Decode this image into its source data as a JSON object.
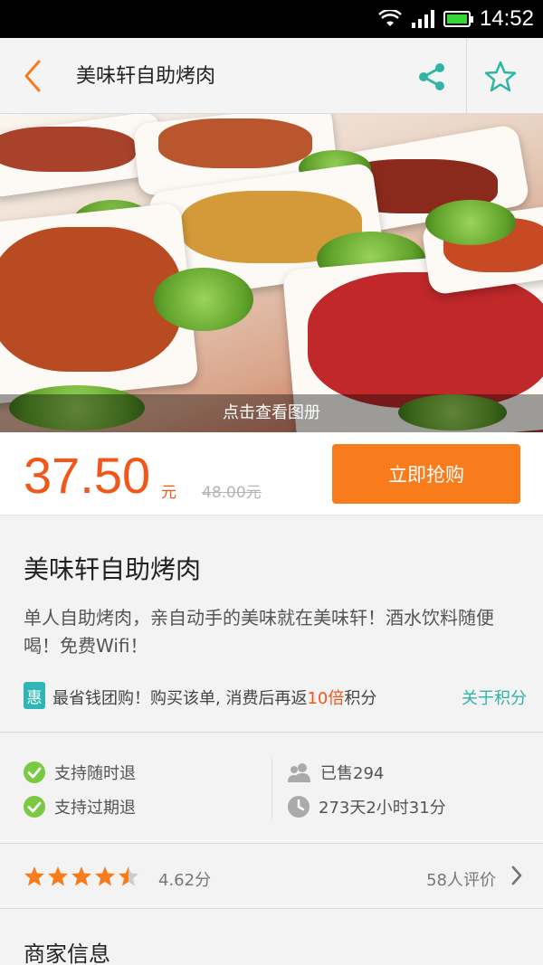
{
  "status_bar": {
    "time": "14:52"
  },
  "header": {
    "title": "美味轩自助烤肉"
  },
  "hero": {
    "album_label": "点击查看图册"
  },
  "price_bar": {
    "price": "37.50",
    "unit": "元",
    "original_price": "48.00元",
    "buy_label": "立即抢购"
  },
  "info": {
    "title": "美味轩自助烤肉",
    "description": "单人自助烤肉，亲自动手的美味就在美味轩！酒水饮料随便喝！免费Wifi！",
    "promo_icon": "惠",
    "promo_prefix": "最省钱团购！购买该单, 消费后再返",
    "promo_highlight": "10倍",
    "promo_suffix": "积分",
    "points_link": "关于积分"
  },
  "features": {
    "anytime_refund": "支持随时退",
    "expired_refund": "支持过期退",
    "sold": "已售294",
    "remaining": "273天2小时31分"
  },
  "rating": {
    "stars": 4.5,
    "score": "4.62分",
    "reviews": "58人评价"
  },
  "merchant": {
    "title": "商家信息"
  },
  "colors": {
    "accent": "#f87c1b",
    "price": "#f2571a",
    "teal": "#2fb5a8",
    "check": "#7ac943"
  }
}
